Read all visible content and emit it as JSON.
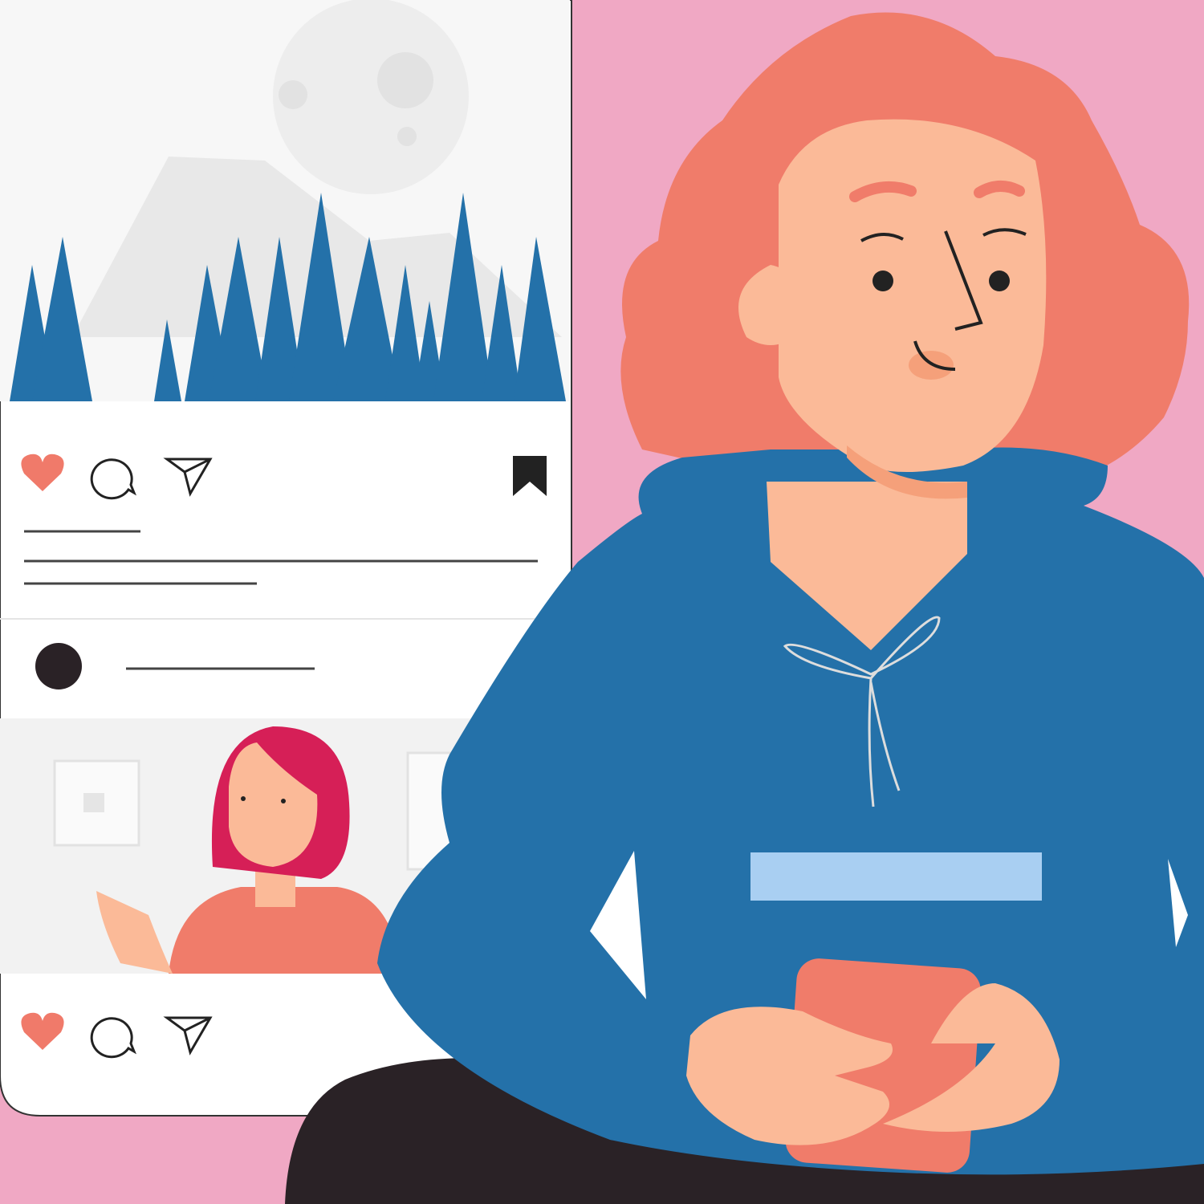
{
  "colors": {
    "background": "#F0A8C4",
    "phone_screen": "#FFFFFF",
    "photo_bg": "#F7F7F7",
    "trees": "#2471A9",
    "heart": "#F07A6A",
    "hair": "#F07C6A",
    "skin": "#FBBA98",
    "hoodie": "#2471A9",
    "pants": "#2A2226",
    "phone_case": "#F07C6A",
    "chest_badge": "#A9CFF2",
    "small_person_hair": "#D61F57"
  },
  "post1": {
    "icons": [
      "heart-icon",
      "comment-icon",
      "send-icon",
      "bookmark-icon"
    ]
  },
  "post2": {
    "icons": [
      "heart-icon",
      "comment-icon",
      "send-icon"
    ]
  }
}
